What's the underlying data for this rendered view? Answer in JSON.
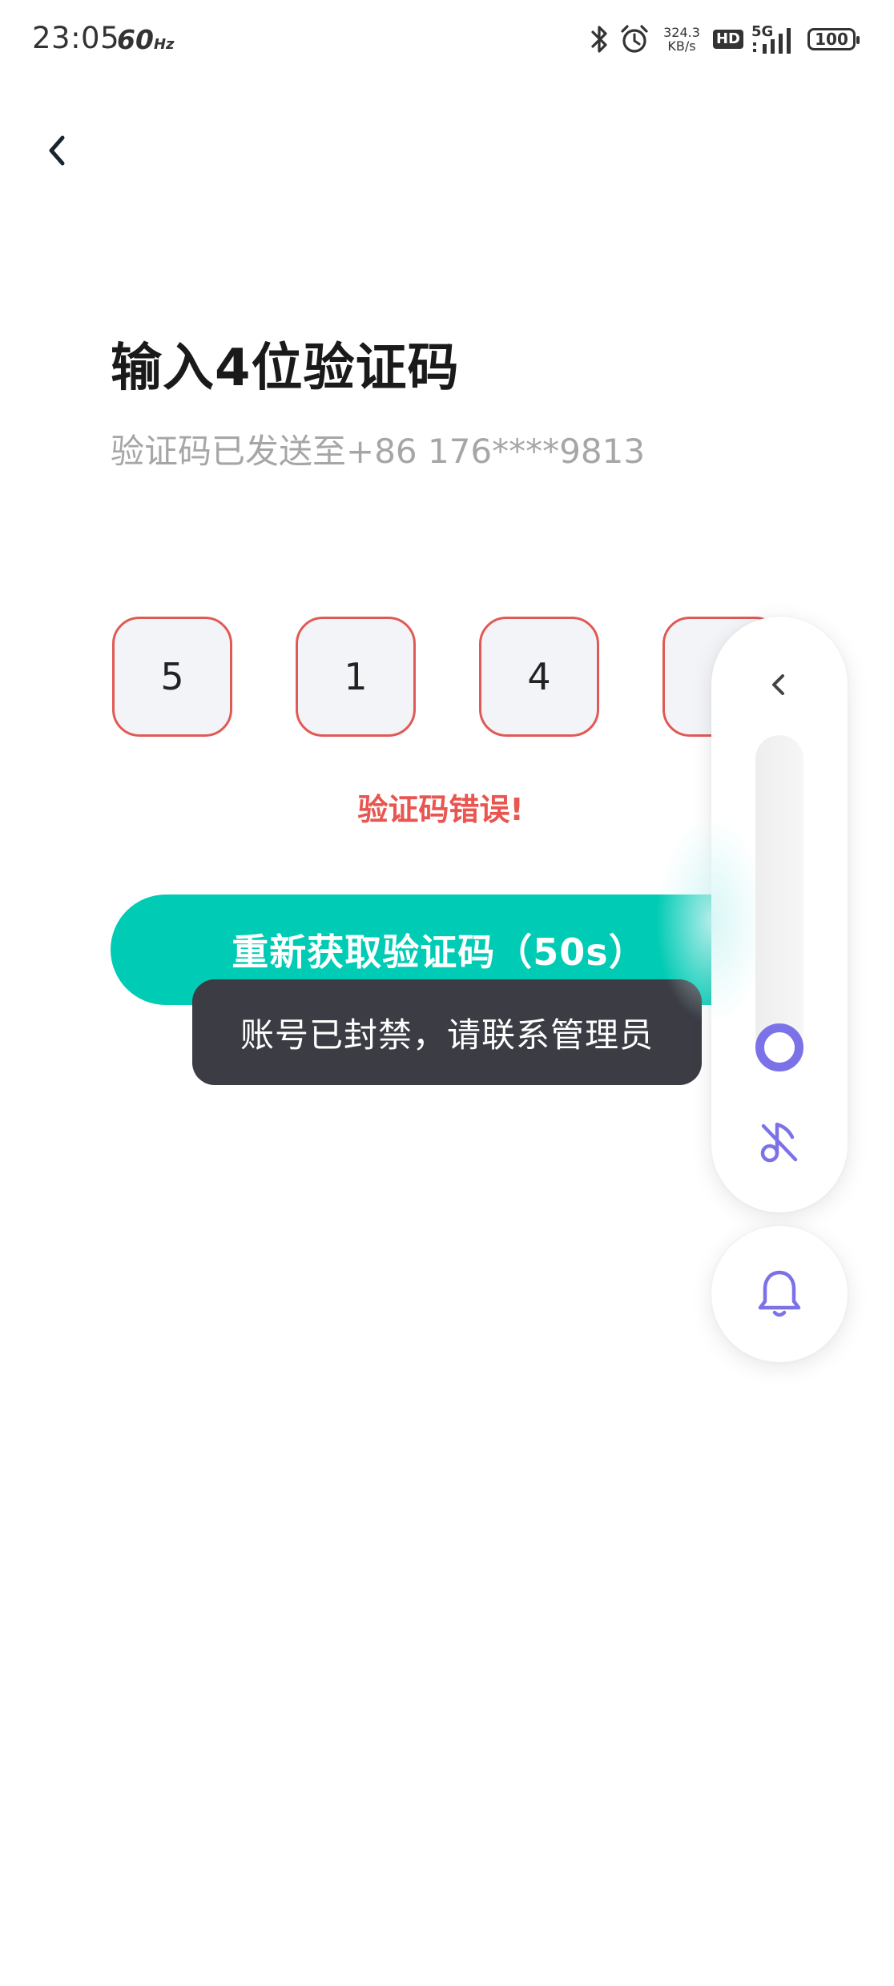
{
  "status_bar": {
    "time": "23:05",
    "refresh_rate": "60",
    "refresh_unit": "Hz",
    "net_speed_value": "324.3",
    "net_speed_unit": "KB/s",
    "hd_label": "HD",
    "network_label": "5G",
    "battery": "100"
  },
  "header": {
    "title": "输入4位验证码",
    "subtitle": "验证码已发送至+86 176****9813"
  },
  "code_boxes": [
    "5",
    "1",
    "4",
    ""
  ],
  "error_message": "验证码错误!",
  "resend_button": {
    "label": "重新获取验证码（50s）"
  },
  "toast": {
    "message": "账号已封禁，请联系管理员"
  },
  "volume_panel": {
    "level": 0.1
  },
  "colors": {
    "accent": "#00cbb4",
    "error": "#e9554f",
    "box_border": "#e05a55",
    "volume_accent": "#7c72e8",
    "toast_bg": "#3b3c44"
  }
}
